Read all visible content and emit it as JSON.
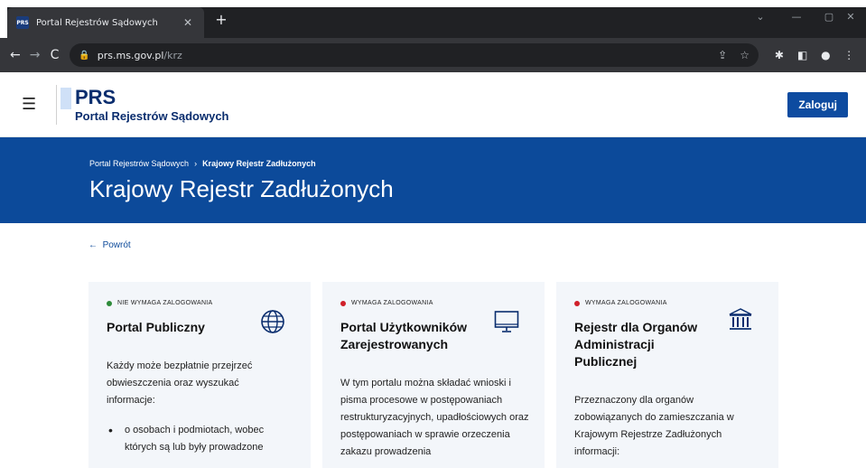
{
  "browser": {
    "tab_title": "Portal Rejestrów Sądowych",
    "favicon_text": "PRS",
    "url_host": "prs.ms.gov.pl",
    "url_path": "/krz"
  },
  "header": {
    "logo_big": "PRS",
    "logo_sub": "Portal Rejestrów Sądowych",
    "login_label": "Zaloguj"
  },
  "hero": {
    "breadcrumb_home": "Portal Rejestrów Sądowych",
    "breadcrumb_current": "Krajowy Rejestr Zadłużonych",
    "title": "Krajowy Rejestr Zadłużonych"
  },
  "back_label": "Powrót",
  "cards": [
    {
      "badge": "NIE WYMAGA ZALOGOWANIA",
      "badge_color": "#2e8b3a",
      "title": "Portal Publiczny",
      "text": "Każdy może bezpłatnie przejrzeć obwieszczenia oraz wyszukać informacje:",
      "bullet": "o osobach i podmiotach, wobec których są lub były prowadzone"
    },
    {
      "badge": "WYMAGA ZALOGOWANIA",
      "badge_color": "#d0202a",
      "title": "Portal Użytkowników Zarejestrowanych",
      "text": "W tym portalu można składać wnioski i pisma procesowe w postępowaniach restrukturyzacyjnych, upadłościowych oraz postępowaniach w sprawie orzeczenia zakazu prowadzenia"
    },
    {
      "badge": "WYMAGA ZALOGOWANIA",
      "badge_color": "#d0202a",
      "title": "Rejestr dla Organów Administracji Publicznej",
      "text": "Przeznaczony dla organów zobowiązanych do zamieszczania w Krajowym Rejestrze Zadłużonych informacji:"
    }
  ]
}
